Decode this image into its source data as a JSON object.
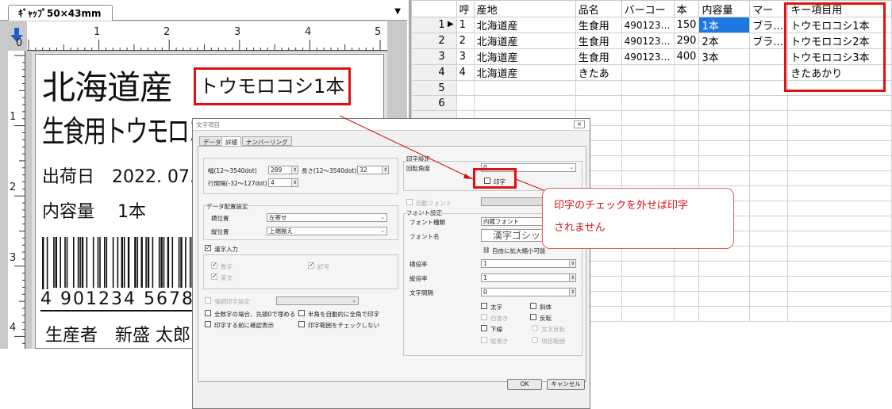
{
  "designer": {
    "tab_label": "ｷﾞｬｯﾌﾟ50×43mm",
    "ruler_h": [
      "0",
      "1",
      "2",
      "3",
      "4",
      "5"
    ],
    "ruler_v": [
      "1",
      "2",
      "3",
      "4"
    ],
    "label": {
      "origin": "北海道産",
      "key_item": "トウモロコシ1本",
      "product": "生食用トウモロコシ",
      "ship_date": "出荷日　2022. 07.",
      "volume": "内容量　 1本",
      "barcode_digits": "4 901234 5678",
      "producer": "生産者　新盛 太郎"
    }
  },
  "grid": {
    "headers": [
      "",
      "呼",
      "産地",
      "品名",
      "バーコー",
      "本",
      "内容量",
      "マー",
      "キー項目用"
    ],
    "rows": [
      [
        "1",
        "1",
        "北海道産",
        "生食用",
        "490123…",
        "150",
        "1本",
        "ブラ…",
        "トウモロコシ1本"
      ],
      [
        "2",
        "2",
        "北海道産",
        "生食用",
        "490123…",
        "290",
        "2本",
        "ブラ…",
        "トウモロコシ2本"
      ],
      [
        "3",
        "3",
        "北海道産",
        "生食用",
        "490123…",
        "400",
        "3本",
        "",
        "トウモロコシ3本"
      ],
      [
        "4",
        "4",
        "北海道産",
        "きたあ",
        "",
        "",
        "",
        "",
        "きたあかり"
      ],
      [
        "5",
        "",
        "",
        "",
        "",
        "",
        "",
        "",
        ""
      ],
      [
        "6",
        "",
        "",
        "",
        "",
        "",
        "",
        "",
        ""
      ],
      [
        "",
        "",
        "",
        "",
        "",
        "",
        "",
        "",
        ""
      ],
      [
        "",
        "",
        "",
        "",
        "",
        "",
        "",
        "",
        ""
      ],
      [
        "",
        "",
        "",
        "",
        "",
        "",
        "",
        "",
        ""
      ],
      [
        "",
        "",
        "",
        "",
        "",
        "",
        "",
        "",
        ""
      ],
      [
        "",
        "",
        "",
        "",
        "",
        "",
        "",
        "",
        ""
      ],
      [
        "",
        "",
        "",
        "",
        "",
        "",
        "",
        "",
        ""
      ],
      [
        "",
        "",
        "",
        "",
        "",
        "",
        "",
        "",
        ""
      ],
      [
        "",
        "",
        "",
        "",
        "",
        "",
        "",
        "",
        ""
      ],
      [
        "",
        "",
        "",
        "",
        "",
        "",
        "",
        "",
        ""
      ],
      [
        "",
        "",
        "",
        "",
        "",
        "",
        "",
        "",
        ""
      ],
      [
        "",
        "",
        "",
        "",
        "",
        "",
        "",
        "",
        ""
      ],
      [
        "",
        "",
        "",
        "",
        "",
        "",
        "",
        "",
        ""
      ],
      [
        "",
        "",
        "",
        "",
        "",
        "",
        "",
        "",
        ""
      ],
      [
        "",
        "",
        "",
        "",
        "",
        "",
        "",
        "",
        ""
      ]
    ]
  },
  "dialog": {
    "title": "文字項目",
    "tabs": [
      "データ",
      "詳細",
      "ナンバーリング"
    ],
    "width_label": "幅(12〜3540dot)",
    "width_value": "289",
    "length_label": "長さ(12〜3540dot)",
    "length_value": "32",
    "line_spacing_label": "行間隔(-32〜127dot)",
    "line_spacing_value": "4",
    "data_layout_group": "データ配置設定",
    "h_position_label": "横位置",
    "h_position_value": "左寄せ",
    "v_position_label": "縦位置",
    "v_position_value": "上端揃え",
    "kanji_input": "漢字入力",
    "digits": "数字",
    "symbols": "記号",
    "alpha": "英文",
    "force_print": "強調印字設定",
    "fill_zero": "全数字の場合、先頭0で埋める",
    "auto_fullwidth": "半角を自動的に全角で印字",
    "confirm_before_print": "印字する前に確認表示",
    "no_range_check": "印字範囲をチェックしない",
    "print_settings": "印字設定",
    "rotation_label": "回転角度",
    "rotation_value": "0",
    "print_label": "印字",
    "auto_font": "自動フォント",
    "font_settings": "フォント設定",
    "font_type_label": "フォント種類",
    "font_type_value": "内蔵フォント",
    "font_name_label": "フォント名",
    "font_name_value": "漢字ゴシック",
    "scalable_note": "自由に拡大縮小可能",
    "h_scale_label": "横倍率",
    "h_scale_value": "1",
    "v_scale_label": "縦倍率",
    "v_scale_value": "1",
    "char_spacing_label": "文字間隔",
    "char_spacing_value": "0",
    "bold": "太字",
    "italic": "斜体",
    "outline": "白抜き",
    "invert": "反転",
    "underline": "下線",
    "char_invert": "文字反転",
    "vertical": "縦書き",
    "item_range": "項目範囲",
    "ok": "OK",
    "cancel": "キャンセル"
  },
  "callout": {
    "line1": "印字のチェックを外せば印字",
    "line2": "されません"
  },
  "colors": {
    "accent_red": "#e01010",
    "selection_blue": "#1e78e0"
  }
}
